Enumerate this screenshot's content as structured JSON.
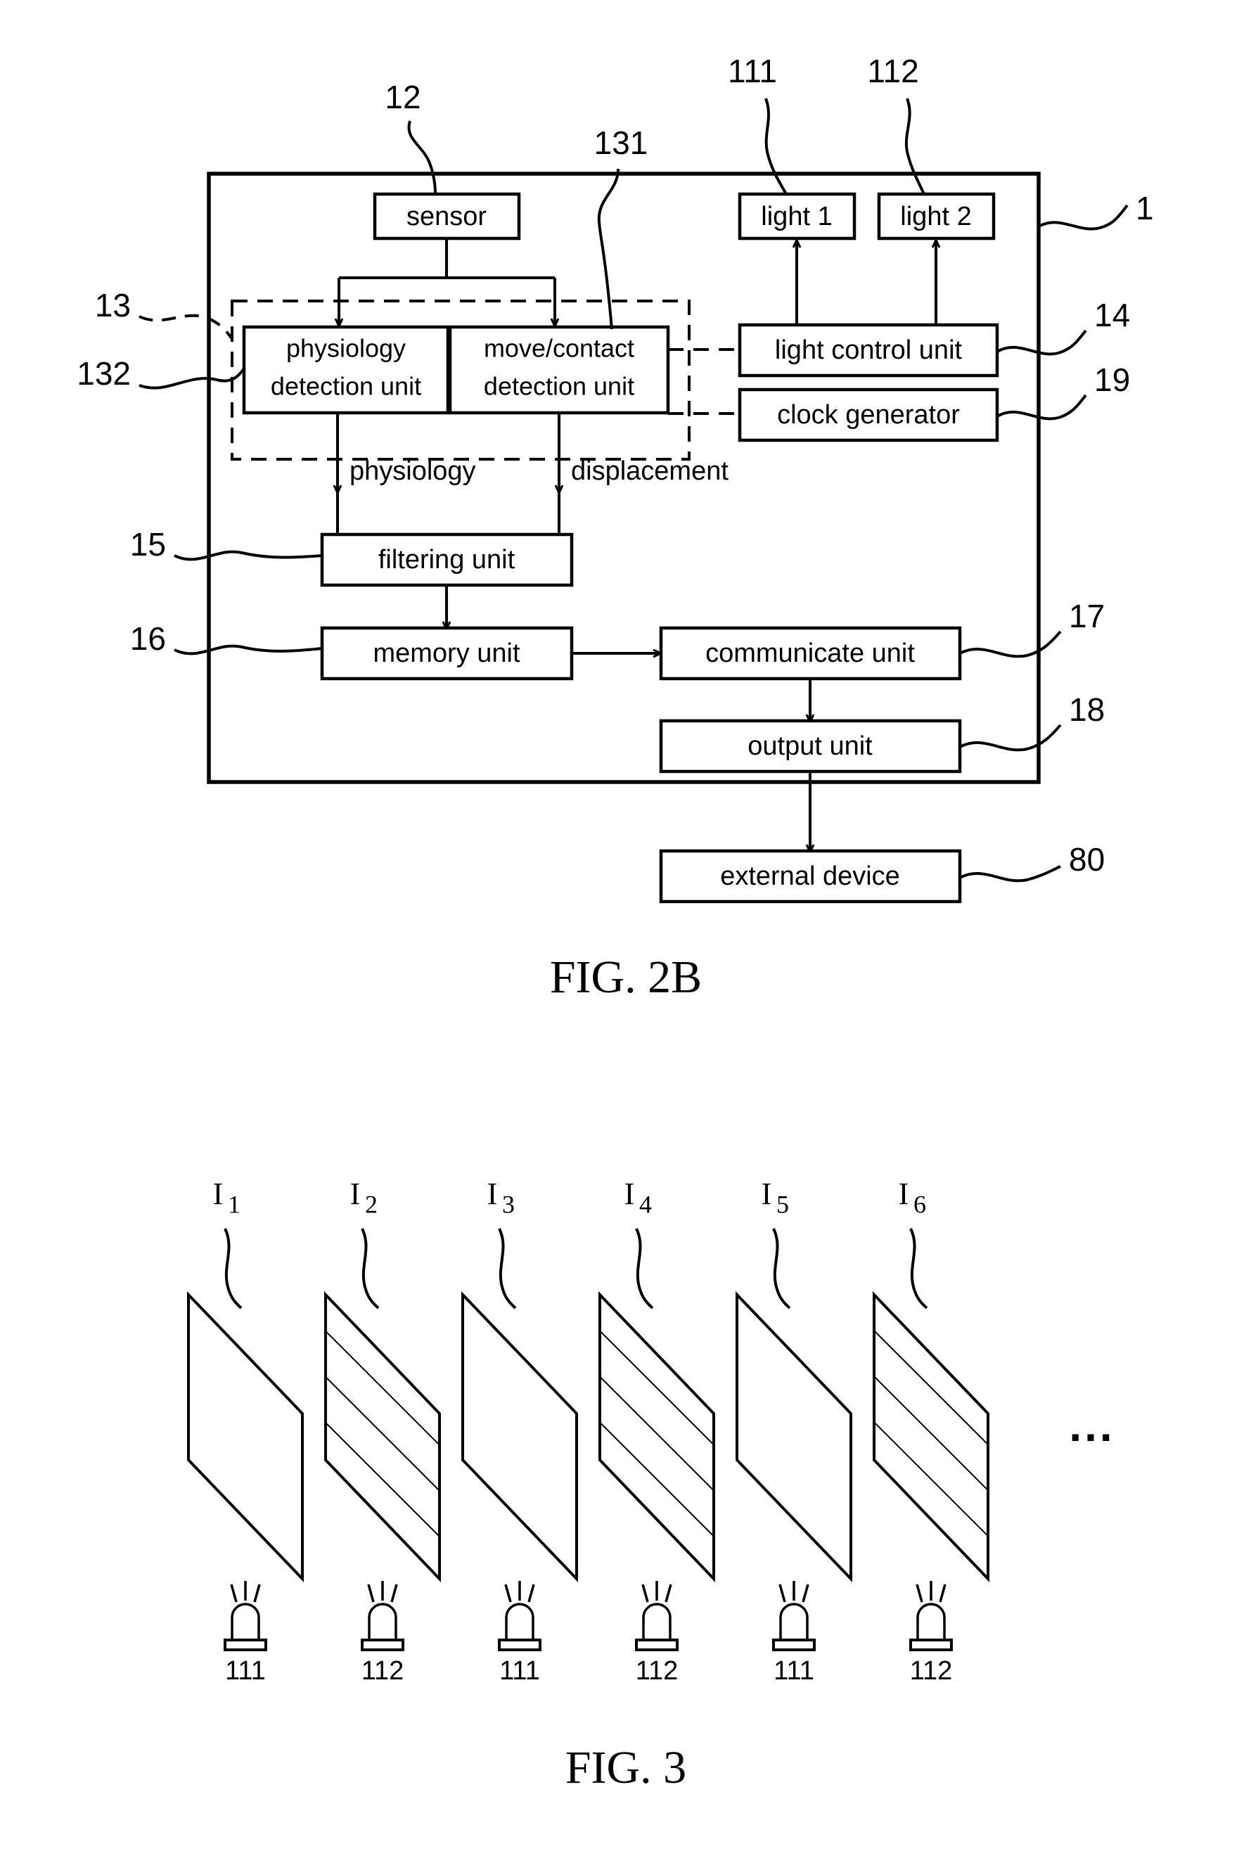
{
  "figures": [
    {
      "id": "fig2b",
      "caption": "FIG. 2B",
      "device_ref": "1",
      "blocks": [
        {
          "key": "sensor",
          "label": "sensor",
          "ref": "12"
        },
        {
          "key": "light1",
          "label": "light 1",
          "ref": "111"
        },
        {
          "key": "light2",
          "label": "light 2",
          "ref": "112"
        },
        {
          "key": "physiology",
          "label_line1": "physiology",
          "label_line2": "detection unit",
          "ref": "132"
        },
        {
          "key": "movecontact",
          "label_line1": "move/contact",
          "label_line2": "detection unit",
          "ref": "131"
        },
        {
          "key": "detection_group",
          "label": "",
          "ref": "13"
        },
        {
          "key": "lightcontrol",
          "label": "light control unit",
          "ref": "14"
        },
        {
          "key": "clockgen",
          "label": "clock generator",
          "ref": "19"
        },
        {
          "key": "filtering",
          "label": "filtering unit",
          "ref": "15"
        },
        {
          "key": "memory",
          "label": "memory unit",
          "ref": "16"
        },
        {
          "key": "communicate",
          "label": "communicate unit",
          "ref": "17"
        },
        {
          "key": "output",
          "label": "output unit",
          "ref": "18"
        },
        {
          "key": "external",
          "label": "external device",
          "ref": "80"
        }
      ],
      "signal_labels": [
        {
          "key": "physiology_signal",
          "label": "physiology"
        },
        {
          "key": "displacement_signal",
          "label": "displacement"
        }
      ]
    },
    {
      "id": "fig3",
      "caption": "FIG. 3",
      "frames": [
        {
          "label": "I",
          "sub": "1",
          "hatched": false,
          "lamp": "111"
        },
        {
          "label": "I",
          "sub": "2",
          "hatched": true,
          "lamp": "112"
        },
        {
          "label": "I",
          "sub": "3",
          "hatched": false,
          "lamp": "111"
        },
        {
          "label": "I",
          "sub": "4",
          "hatched": true,
          "lamp": "112"
        },
        {
          "label": "I",
          "sub": "5",
          "hatched": false,
          "lamp": "111"
        },
        {
          "label": "I",
          "sub": "6",
          "hatched": true,
          "lamp": "112"
        }
      ],
      "continuation": "..."
    }
  ],
  "colors": {
    "ink": "#000000",
    "paper": "#ffffff"
  }
}
